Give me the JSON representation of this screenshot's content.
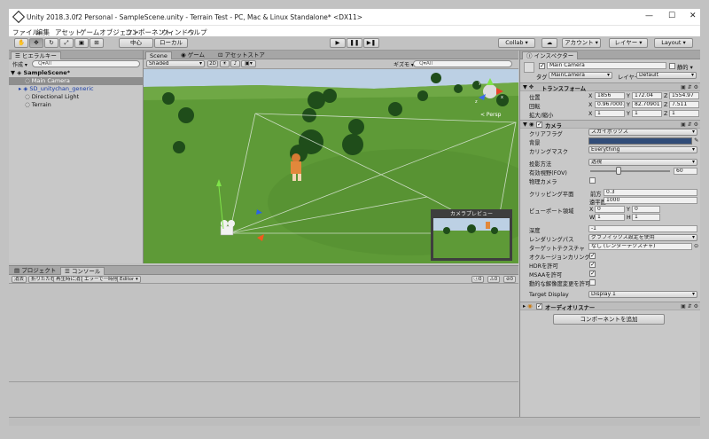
{
  "window": {
    "title": "Unity 2018.3.0f2 Personal - SampleScene.unity - Terrain Test - PC, Mac & Linux Standalone* <DX11>",
    "minimize": "—",
    "maximize": "☐",
    "close": "✕"
  },
  "menu": [
    "ファイル",
    "編集",
    "アセット",
    "ゲームオブジェクト",
    "コンポーネント",
    "ウィンドウ",
    "ヘルプ"
  ],
  "toolbar": {
    "pivot_label": "中心",
    "space_label": "ローカル",
    "collab_label": "Collab ▾",
    "account_label": "アカウント ▾",
    "layers_label": "レイヤー ▾",
    "layout_label": "Layout ▾"
  },
  "hierarchy": {
    "tab": "ヒエラルキー",
    "create": "作成 ▾",
    "search_placeholder": "Q▾All",
    "scene": "SampleScene*",
    "items": [
      "Main Camera",
      "SD_unitychan_generic",
      "Directional Light",
      "Terrain"
    ]
  },
  "scene_view": {
    "tabs": [
      "Scene",
      "ゲーム",
      "アセットストア"
    ],
    "shading": "Shaded",
    "mode_2d": "2D",
    "gizmos": "ギズモ ▾",
    "search_placeholder": "Q▾All",
    "persp": "< Persp",
    "camera_preview_title": "カメラプレビュー",
    "axis_y": "y",
    "axis_x": "x",
    "axis_z": "z"
  },
  "project": {
    "tabs": [
      "プロジェクト",
      "コンソール"
    ],
    "buttons": [
      "消去",
      "折りたたむ",
      "再生時に消去",
      "エラーで一時停止",
      "Editor ▾"
    ],
    "counts": [
      "0",
      "0",
      "0"
    ]
  },
  "inspector": {
    "tab": "インスペクター",
    "object_name": "Main Camera",
    "static_label": "静的 ▾",
    "tag_label": "タグ",
    "tag_value": "MainCamera",
    "layer_label": "レイヤー",
    "layer_value": "Default",
    "transform": {
      "title": "トランスフォーム",
      "position_label": "位置",
      "rotation_label": "回転",
      "scale_label": "拡大/縮小",
      "position": {
        "x": "1856",
        "y": "172.04",
        "z": "1554.97"
      },
      "rotation": {
        "x": "0.9670001",
        "y": "82.70901",
        "z": "7.511"
      },
      "scale": {
        "x": "1",
        "y": "1",
        "z": "1"
      }
    },
    "camera": {
      "title": "カメラ",
      "clear_flags_label": "クリアフラグ",
      "clear_flags": "スカイボックス",
      "background_label": "背景",
      "culling_label": "カリングマスク",
      "culling": "Everything",
      "projection_label": "投影方法",
      "projection": "透視",
      "fov_label": "有効視野(FOV)",
      "fov": "60",
      "fov_fraction": 0.36,
      "physical_label": "物理カメラ",
      "clipping_label": "クリッピング平面",
      "near_label": "前方",
      "near": "0.3",
      "far_label": "遠平面",
      "far": "1000",
      "viewport_label": "ビューポート領域",
      "vx": "0",
      "vy": "0",
      "vw": "1",
      "vh": "1",
      "depth_label": "深度",
      "depth": "-1",
      "render_path_label": "レンダリングパス",
      "render_path": "グラフィックス設定を使用",
      "target_texture_label": "ターゲットテクスチャ",
      "target_texture": "なし (レンダーテクスチャ)",
      "occlusion_label": "オクルージョンカリング",
      "hdr_label": "HDRを許可",
      "msaa_label": "MSAAを許可",
      "dynamic_label": "動的な解像度変更を許可",
      "target_display_label": "Target Display",
      "target_display": "Display 1"
    },
    "audio_listener": "オーディオリスナー",
    "add_component": "コンポーネントを追加"
  },
  "colors": {
    "background_swatch": "#314d79",
    "hdr_bg": "#c2c2c2"
  }
}
